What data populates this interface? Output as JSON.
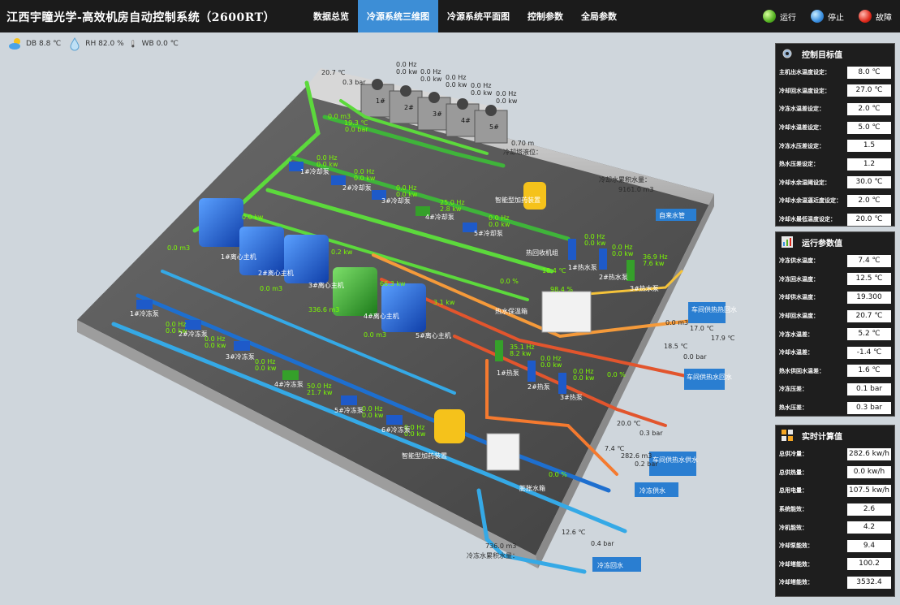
{
  "header": {
    "title": "江西宇瞳光学-高效机房自动控制系统（2600RT）",
    "tabs": [
      {
        "label": "数据总览",
        "active": false
      },
      {
        "label": "冷源系统三维图",
        "active": true
      },
      {
        "label": "冷源系统平面图",
        "active": false
      },
      {
        "label": "控制参数",
        "active": false
      },
      {
        "label": "全局参数",
        "active": false
      }
    ],
    "legend": [
      {
        "label": "运行",
        "color": "#55b322"
      },
      {
        "label": "停止",
        "color": "#3a8fe0"
      },
      {
        "label": "故障",
        "color": "#e02a1c"
      }
    ]
  },
  "weather": {
    "db_label": "DB",
    "db_value": "8.8 ℃",
    "rh_label": "RH",
    "rh_value": "82.0 %",
    "wb_label": "WB",
    "wb_value": "0.0 ℃"
  },
  "scene": {
    "towers_top": {
      "temp": "20.7 ℃",
      "press": "0.3 bar"
    },
    "towers_green": {
      "a": "0.0 m3",
      "b": "19.3 ℃",
      "c": "0.0 bar"
    },
    "tower_readings": [
      {
        "hz": "0.0 Hz",
        "kw": "0.0 kw"
      },
      {
        "hz": "0.0 Hz",
        "kw": "0.0 kw"
      },
      {
        "hz": "0.0 Hz",
        "kw": "0.0 kw"
      },
      {
        "hz": "0.0 Hz",
        "kw": "0.0 kw"
      },
      {
        "hz": "0.0 Hz",
        "kw": "0.0 kw"
      }
    ],
    "tower_labels": [
      "1#",
      "2#",
      "3#",
      "4#",
      "5#"
    ],
    "level": "0.70 m",
    "level_label": "冷却塔液位：",
    "make_up_total_label": "冷却水累积水量：",
    "make_up_total": "9161.0 m3",
    "city_water": "自来水管",
    "cw_pump_readings": [
      {
        "hz": "0.0 Hz",
        "kw": "0.0 kw"
      },
      {
        "hz": "0.0 Hz",
        "kw": "0.0 kw"
      },
      {
        "hz": "0.0 Hz",
        "kw": "0.0 kw"
      },
      {
        "hz": "25.0 Hz",
        "kw": "2.8 kw"
      },
      {
        "hz": "0.0 Hz",
        "kw": "0.0 kw"
      }
    ],
    "cw_pump_labels": [
      "1#冷却泵",
      "2#冷却泵",
      "3#冷却泵",
      "4#冷却泵",
      "5#冷却泵"
    ],
    "chillers": [
      {
        "label": "1#离心主机",
        "flow": "0.0 m3",
        "kw": "0.0 kw"
      },
      {
        "label": "2#离心主机",
        "flow": "0.0 m3",
        "kw": ""
      },
      {
        "label": "3#离心主机",
        "flow": "",
        "kw": "0.2 kw"
      },
      {
        "label": "4#离心主机",
        "flow": "336.6 m3",
        "kw": "66.3 kw"
      },
      {
        "label": "5#离心主机",
        "flow": "0.0 m3",
        "kw": "3.1 kw"
      }
    ],
    "dosing_top": "智能型加药装置",
    "dosing_bottom": "智能型加药装置",
    "heat_pump_label": "热水保温箱",
    "hw_pumps": [
      {
        "label": "1#热水泵",
        "hz": "0.0 Hz",
        "kw": "0.0 kw"
      },
      {
        "label": "2#热水泵",
        "hz": "0.0 Hz",
        "kw": "0.0 kw"
      },
      {
        "label": "3#热水泵",
        "hz": "36.9 Hz",
        "kw": "7.6 kw"
      }
    ],
    "hw_readings": {
      "a": "18.4 ℃",
      "b": "0.0 %",
      "c": "98.4 %"
    },
    "heat_recovery": "热回收机组",
    "hw_supply_out": {
      "flow": "0.0 m3",
      "t1": "17.0 ℃",
      "t2": "17.9 ℃",
      "t3": "18.5 ℃",
      "p": "0.0 bar"
    },
    "hw_supply_labels": [
      "车间供热热回水",
      "车间供热水回水"
    ],
    "ch_pumps": [
      {
        "label": "1#冷冻泵",
        "hz": "0.0 Hz",
        "kw": "0.0 kw"
      },
      {
        "label": "2#冷冻泵",
        "hz": "0.0 Hz",
        "kw": "0.0 kw"
      },
      {
        "label": "3#冷冻泵",
        "hz": "0.0 Hz",
        "kw": "0.0 kw"
      },
      {
        "label": "4#冷冻泵",
        "hz": "50.0 Hz",
        "kw": "21.7 kw"
      },
      {
        "label": "5#冷冻泵",
        "hz": "0.0 Hz",
        "kw": "0.0 kw"
      },
      {
        "label": "6#冷冻泵",
        "hz": "0.0 Hz",
        "kw": "0.0 kw"
      }
    ],
    "heating_pumps": [
      {
        "label": "1#热泵",
        "hz": "35.1 Hz",
        "kw": "8.2 kw"
      },
      {
        "label": "2#热泵",
        "hz": "0.0 Hz",
        "kw": "0.0 kw"
      },
      {
        "label": "3#热泵",
        "hz": "0.0 Hz",
        "kw": "0.0 kw"
      }
    ],
    "heating_pct": "0.0 %",
    "workshop": {
      "t": "20.0 ℃",
      "p": "0.3 bar",
      "label": "车间供热水供水"
    },
    "chw_supply": {
      "t": "7.4 ℃",
      "flow": "282.6 m3",
      "p": "0.2 bar",
      "label": "冷冻供水"
    },
    "chw_return": {
      "t": "12.6 ℃",
      "p": "0.4 bar",
      "label": "冷冻回水"
    },
    "chw_total_label": "冷冻水累积水量：",
    "chw_total": "736.0 m3",
    "vent_label": "膨胀水箱",
    "vent_pct": "0.0 %"
  },
  "panels": {
    "target": {
      "title": "控制目标值",
      "rows": [
        {
          "k": "主机出水温度设定：",
          "v": "8.0 ℃"
        },
        {
          "k": "冷却回水温度设定：",
          "v": "27.0 ℃"
        },
        {
          "k": "冷冻水温差设定：",
          "v": "2.0 ℃"
        },
        {
          "k": "冷却水温差设定：",
          "v": "5.0 ℃"
        },
        {
          "k": "冷冻水压差设定：",
          "v": "1.5"
        },
        {
          "k": "热水压差设定：",
          "v": "1.2"
        },
        {
          "k": "冷却水余湿阈设定：",
          "v": "30.0 ℃"
        },
        {
          "k": "冷却水余温逼近度设定：",
          "v": "2.0 ℃"
        },
        {
          "k": "冷却水最低温度设定：",
          "v": "20.0 ℃"
        }
      ]
    },
    "run": {
      "title": "运行参数值",
      "rows": [
        {
          "k": "冷冻供水温度：",
          "v": "7.4 ℃"
        },
        {
          "k": "冷冻回水温度：",
          "v": "12.5 ℃"
        },
        {
          "k": "冷却供水温度：",
          "v": "19.300"
        },
        {
          "k": "冷却回水温度：",
          "v": "20.7 ℃"
        },
        {
          "k": "冷冻水温差：",
          "v": "5.2 ℃"
        },
        {
          "k": "冷却水温差：",
          "v": "-1.4 ℃"
        },
        {
          "k": "热水供回水温差：",
          "v": "1.6 ℃"
        },
        {
          "k": "冷冻压差：",
          "v": "0.1 bar"
        },
        {
          "k": "热水压差：",
          "v": "0.3 bar"
        }
      ]
    },
    "calc": {
      "title": "实时计算值",
      "rows": [
        {
          "k": "总供冷量：",
          "v": "282.6 kw/h"
        },
        {
          "k": "总供热量：",
          "v": "0.0 kw/h"
        },
        {
          "k": "总用电量：",
          "v": "107.5 kw/h"
        },
        {
          "k": "系统能效：",
          "v": "2.6"
        },
        {
          "k": "冷机能效：",
          "v": "4.2"
        },
        {
          "k": "冷却泵能效：",
          "v": "9.4"
        },
        {
          "k": "冷却塔能效：",
          "v": "100.2"
        },
        {
          "k": "冷却塔能效：",
          "v": "3532.4"
        }
      ]
    }
  }
}
